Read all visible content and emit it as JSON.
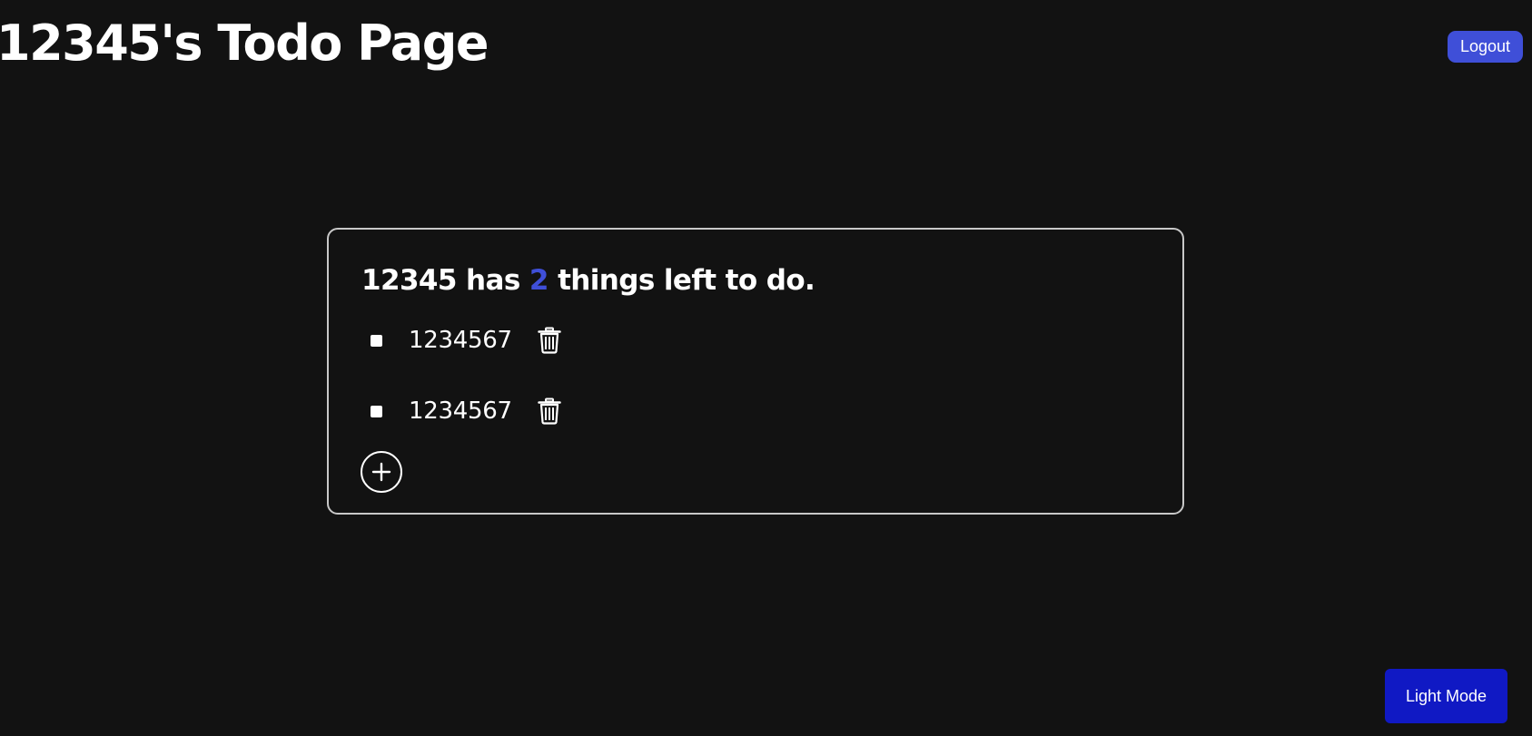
{
  "header": {
    "title": "12345's Todo Page",
    "logout_label": "Logout"
  },
  "todo_card": {
    "summary_prefix": "12345 has",
    "remaining_count": "2",
    "summary_suffix": "things left to do.",
    "items": [
      {
        "text": "1234567",
        "checked": false
      },
      {
        "text": "1234567",
        "checked": false
      }
    ],
    "add_icon": "plus-circle-icon",
    "delete_icon": "trash-icon"
  },
  "footer": {
    "theme_toggle_label": "Light Mode"
  },
  "colors": {
    "background": "#121212",
    "accent": "#3f4fd8",
    "theme_button": "#1019c4",
    "card_border": "#c8c8c8"
  }
}
